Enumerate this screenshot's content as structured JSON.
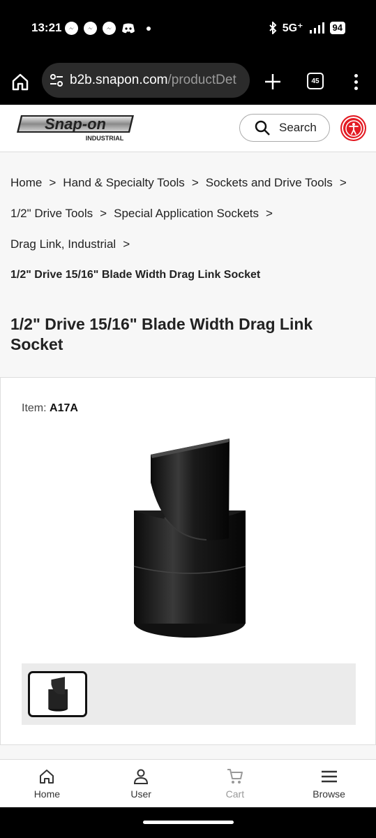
{
  "status_bar": {
    "time": "13:21",
    "network": "5G⁺",
    "battery": "94",
    "notification_icons": [
      "messenger-icon",
      "messenger-icon",
      "messenger-icon",
      "discord-icon"
    ]
  },
  "browser": {
    "url_host": "b2b.snapon.com",
    "url_path": "/productDet",
    "tab_count": "45"
  },
  "header": {
    "logo_text": "Snap-on",
    "logo_subtext": "INDUSTRIAL",
    "search_label": "Search"
  },
  "breadcrumb": {
    "items": [
      "Home",
      "Hand & Specialty Tools",
      "Sockets and Drive Tools",
      "1/2\" Drive Tools",
      "Special Application Sockets",
      "Drag Link, Industrial"
    ],
    "separator": ">",
    "current": "1/2\" Drive 15/16\" Blade Width Drag Link Socket"
  },
  "product": {
    "title": "1/2\" Drive 15/16\" Blade Width Drag Link Socket",
    "item_label": "Item:",
    "item_number": "A17A"
  },
  "bottom_nav": {
    "items": [
      {
        "label": "Home",
        "icon": "home-icon"
      },
      {
        "label": "User",
        "icon": "user-icon"
      },
      {
        "label": "Cart",
        "icon": "cart-icon"
      },
      {
        "label": "Browse",
        "icon": "menu-icon"
      }
    ]
  },
  "colors": {
    "brand_red": "#e31b23",
    "chrome_bg": "#000000",
    "page_bg": "#f7f7f7"
  }
}
